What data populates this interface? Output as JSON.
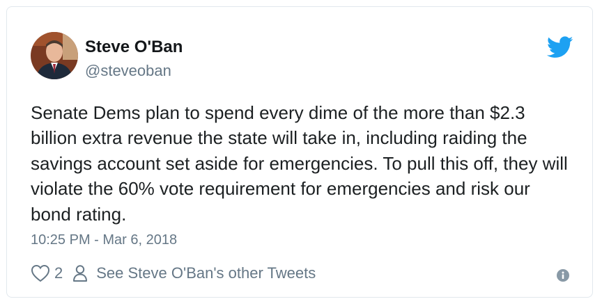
{
  "tweet": {
    "author": {
      "display_name": "Steve O'Ban",
      "handle": "@steveoban",
      "avatar_icon": "profile-photo"
    },
    "text": "Senate Dems plan to spend every dime of the more than $2.3 billion extra revenue the state will take in, including raiding the savings account set aside for emergencies. To pull this off, they will violate the 60% vote requirement for emergencies and risk our bond rating.",
    "timestamp": "10:25 PM - Mar 6, 2018",
    "actions": {
      "like_icon": "heart-icon",
      "like_count": "2",
      "profile_icon": "person-icon",
      "profile_link_text": "See Steve O'Ban's other Tweets"
    },
    "brand_icon": "twitter-bird-icon",
    "info_icon": "info-icon"
  },
  "colors": {
    "brand": "#1da1f2",
    "text": "#1c2022",
    "secondary": "#657786",
    "border": "#e1e8ed"
  }
}
